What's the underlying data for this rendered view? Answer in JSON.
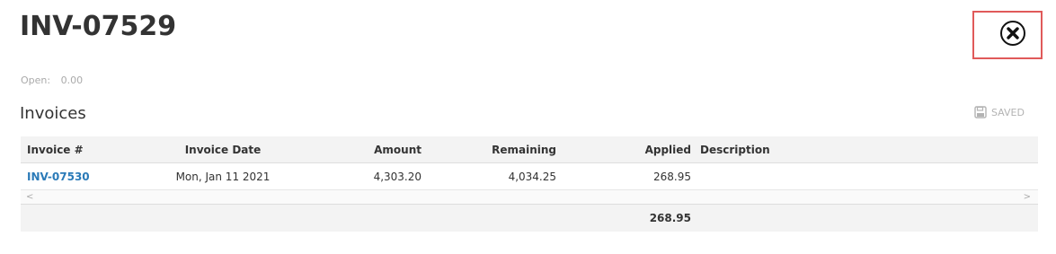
{
  "header": {
    "title": "INV-07529"
  },
  "summary": {
    "open_label": "Open:",
    "open_value": "0.00"
  },
  "section": {
    "title": "Invoices",
    "saved_label": "SAVED"
  },
  "table": {
    "columns": {
      "invoice": "Invoice #",
      "date": "Invoice Date",
      "amount": "Amount",
      "remaining": "Remaining",
      "applied": "Applied",
      "description": "Description"
    },
    "rows": [
      {
        "invoice": "INV-07530",
        "date": "Mon, Jan 11 2021",
        "amount": "4,303.20",
        "remaining": "4,034.25",
        "applied": "268.95",
        "description": ""
      }
    ],
    "scroll_left": "<",
    "scroll_right": ">",
    "footer": {
      "applied_total": "268.95"
    }
  },
  "icons": {
    "close": "close-circle-icon",
    "save": "floppy-disk-icon"
  },
  "colors": {
    "link": "#2a7ab8",
    "highlight": "#e05a5a"
  }
}
